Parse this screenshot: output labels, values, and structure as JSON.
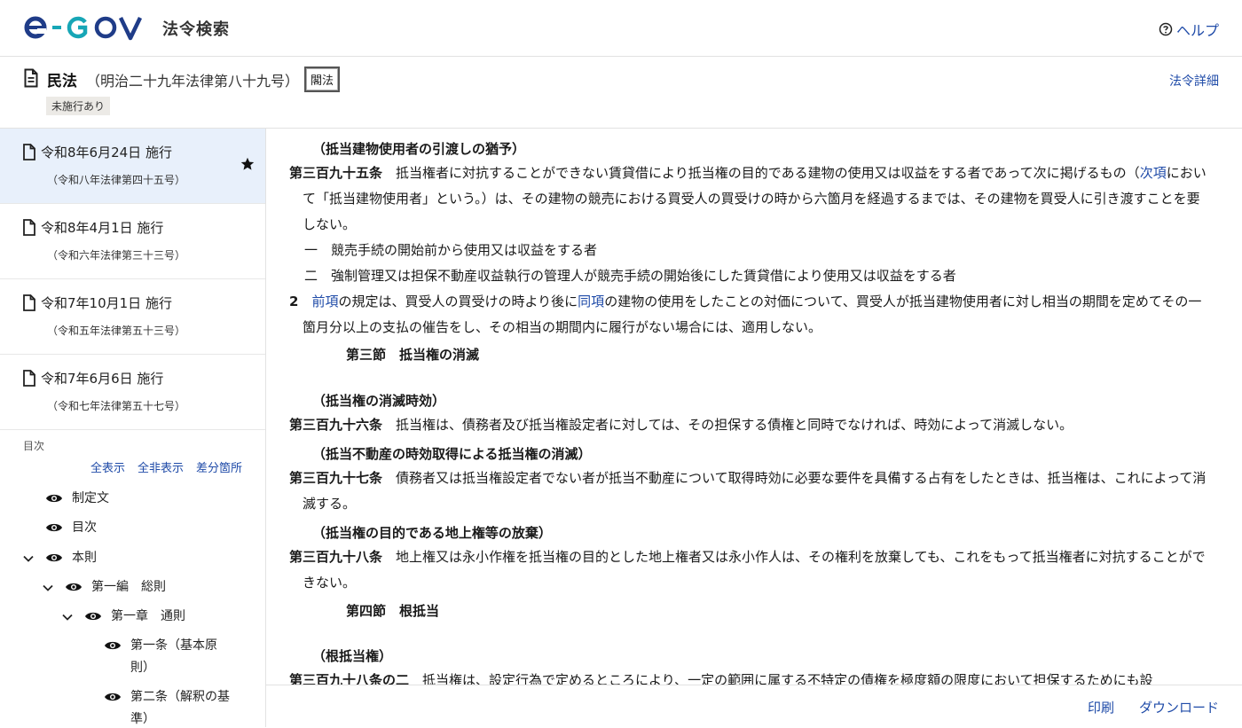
{
  "header": {
    "logo_text": "e-GOV",
    "app_title": "法令検索",
    "help_label": "ヘルプ",
    "colors": {
      "brand_blue": "#1f3c88",
      "brand_teal": "#17a6b6",
      "link": "#1f4ba8"
    }
  },
  "law": {
    "name": "民法",
    "number": "（明治二十九年法律第八十九号）",
    "type": "閣法",
    "badge": "未施行あり",
    "detail_link": "法令詳細"
  },
  "versions": [
    {
      "date": "令和8年6月24日 施行",
      "law": "（令和八年法律第四十五号）",
      "starred": true
    },
    {
      "date": "令和8年4月1日 施行",
      "law": "（令和六年法律第三十三号）",
      "starred": false
    },
    {
      "date": "令和7年10月1日 施行",
      "law": "（令和五年法律第五十三号）",
      "starred": false
    },
    {
      "date": "令和7年6月6日 施行",
      "law": "（令和七年法律第五十七号）",
      "starred": false
    }
  ],
  "toc": {
    "label": "目次",
    "actions": {
      "show_all": "全表示",
      "hide_all": "全非表示",
      "diff": "差分箇所"
    },
    "items": [
      {
        "label": "制定文"
      },
      {
        "label": "目次"
      },
      {
        "label": "本則"
      },
      {
        "label": "第一編　総則"
      },
      {
        "label": "第一章　通則"
      },
      {
        "label": "第一条（基本原",
        "label2": "則）"
      },
      {
        "label": "第二条（解釈の基",
        "label2": "準）"
      }
    ]
  },
  "content": {
    "a395": {
      "caption": "（抵当建物使用者の引渡しの猶予）",
      "num": "第三百九十五条",
      "text_1": "抵当権者に対抗することができない賃貸借により抵当権の目的である建物の使用又は収益をする者であって次に掲げるもの（",
      "link_1": "次項",
      "text_2": "において「抵当建物使用者」という。）は、その建物の競売における買受人の買受けの時から六箇月を経過するまでは、その建物を買受人に引き渡すことを要しない。",
      "item1_no": "一",
      "item1": "競売手続の開始前から使用又は収益をする者",
      "item2_no": "二",
      "item2": "強制管理又は担保不動産収益執行の管理人が競売手続の開始後にした賃貸借により使用又は収益をする者",
      "p2_no": "2",
      "p2_link1": "前項",
      "p2_text1": "の規定は、買受人の買受けの時より後に",
      "p2_link2": "同項",
      "p2_text2": "の建物の使用をしたことの対価について、買受人が抵当建物使用者に対し相当の期間を定めてその一箇月分以上の支払の催告をし、その相当の期間内に履行がない場合には、適用しない。"
    },
    "section3": "第三節　抵当権の消滅",
    "a396": {
      "caption": "（抵当権の消滅時効）",
      "num": "第三百九十六条",
      "text": "抵当権は、債務者及び抵当権設定者に対しては、その担保する債権と同時でなければ、時効によって消滅しない。"
    },
    "a397": {
      "caption": "（抵当不動産の時効取得による抵当権の消滅）",
      "num": "第三百九十七条",
      "text": "債務者又は抵当権設定者でない者が抵当不動産について取得時効に必要な要件を具備する占有をしたときは、抵当権は、これによって消滅する。"
    },
    "a398": {
      "caption": "（抵当権の目的である地上権等の放棄）",
      "num": "第三百九十八条",
      "text": "地上権又は永小作権を抵当権の目的とした地上権者又は永小作人は、その権利を放棄しても、これをもって抵当権者に対抗することができない。"
    },
    "section4": "第四節　根抵当",
    "a398_2": {
      "caption": "（根抵当権）",
      "num": "第三百九十八条の二",
      "text": "抵当権は、設定行為で定めるところにより、一定の範囲に属する不特定の債権を極度額の限度において担保するためにも設"
    }
  },
  "footer": {
    "print": "印刷",
    "download": "ダウンロード"
  }
}
